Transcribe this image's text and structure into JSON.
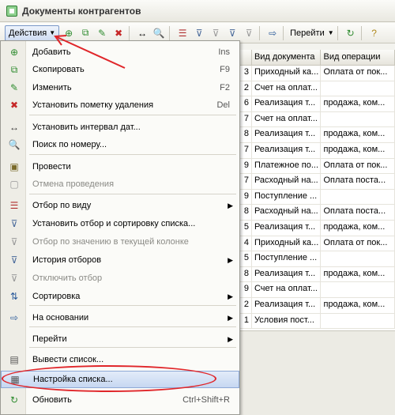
{
  "window": {
    "title": "Документы контрагентов"
  },
  "toolbar": {
    "actions_label": "Действия",
    "goto_label": "Перейти"
  },
  "grid": {
    "headers": [
      "",
      "Вид документа",
      "Вид операции"
    ],
    "rows": [
      [
        "3",
        "Приходный ка...",
        "Оплата от пок..."
      ],
      [
        "2",
        "Счет на оплат...",
        ""
      ],
      [
        "6",
        "Реализация т...",
        "продажа, ком..."
      ],
      [
        "7",
        "Счет на оплат...",
        ""
      ],
      [
        "8",
        "Реализация т...",
        "продажа, ком..."
      ],
      [
        "7",
        "Реализация т...",
        "продажа, ком..."
      ],
      [
        "9",
        "Платежное по...",
        "Оплата от пок..."
      ],
      [
        "7",
        "Расходный на...",
        "Оплата поста..."
      ],
      [
        "9",
        "Поступление ...",
        ""
      ],
      [
        "8",
        "Расходный на...",
        "Оплата поста..."
      ],
      [
        "5",
        "Реализация т...",
        "продажа, ком..."
      ],
      [
        "4",
        "Приходный ка...",
        "Оплата от пок..."
      ],
      [
        "5",
        "Поступление ...",
        ""
      ],
      [
        "8",
        "Реализация т...",
        "продажа, ком..."
      ],
      [
        "9",
        "Счет на оплат...",
        ""
      ],
      [
        "2",
        "Реализация т...",
        "продажа, ком..."
      ],
      [
        "1",
        "Условия пост...",
        ""
      ]
    ]
  },
  "menu": {
    "items": [
      {
        "label": "Добавить",
        "shortcut": "Ins",
        "icon": "plus-circle-icon",
        "glyph": "⊕",
        "color": "#2e8b2e"
      },
      {
        "label": "Скопировать",
        "shortcut": "F9",
        "icon": "copy-icon",
        "glyph": "⧉",
        "color": "#2e8b2e"
      },
      {
        "label": "Изменить",
        "shortcut": "F2",
        "icon": "pencil-icon",
        "glyph": "✎",
        "color": "#2e8b2e"
      },
      {
        "label": "Установить пометку удаления",
        "shortcut": "Del",
        "icon": "delete-mark-icon",
        "glyph": "✖",
        "color": "#c62828"
      },
      {
        "label": "Установить интервал дат...",
        "icon": "date-interval-icon",
        "glyph": "↔",
        "color": "#333"
      },
      {
        "label": "Поиск по номеру...",
        "icon": "search-icon",
        "glyph": "🔍",
        "color": "#333"
      },
      {
        "label": "Провести",
        "icon": "post-document-icon",
        "glyph": "▣",
        "color": "#7a6a2a"
      },
      {
        "label": "Отмена проведения",
        "icon": "cancel-posting-icon",
        "glyph": "▢",
        "color": "#999"
      },
      {
        "label": "Отбор по виду",
        "icon": "filter-by-type-icon",
        "glyph": "☰",
        "color": "#b03030"
      },
      {
        "label": "Установить отбор и сортировку списка...",
        "icon": "filter-sort-icon",
        "glyph": "⊽",
        "color": "#4a6a9a"
      },
      {
        "label": "Отбор по значению в текущей колонке",
        "icon": "filter-value-icon",
        "glyph": "⊽",
        "color": "#999"
      },
      {
        "label": "История отборов",
        "icon": "filter-history-icon",
        "glyph": "⊽",
        "color": "#4a6a9a"
      },
      {
        "label": "Отключить отбор",
        "icon": "filter-off-icon",
        "glyph": "⊽",
        "color": "#999"
      },
      {
        "label": "Сортировка",
        "icon": "sort-icon",
        "glyph": "⇅",
        "color": "#2a5a9a"
      },
      {
        "label": "На основании",
        "icon": "based-on-icon",
        "glyph": "⇨",
        "color": "#2a5a9a"
      },
      {
        "label": "Перейти",
        "icon": "",
        "glyph": "",
        "color": "#333"
      },
      {
        "label": "Вывести список...",
        "icon": "output-list-icon",
        "glyph": "▤",
        "color": "#555"
      },
      {
        "label": "Настройка списка...",
        "icon": "list-settings-icon",
        "glyph": "▦",
        "color": "#555"
      },
      {
        "label": "Обновить",
        "shortcut": "Ctrl+Shift+R",
        "icon": "refresh-icon",
        "glyph": "↻",
        "color": "#2e8b2e"
      }
    ]
  }
}
